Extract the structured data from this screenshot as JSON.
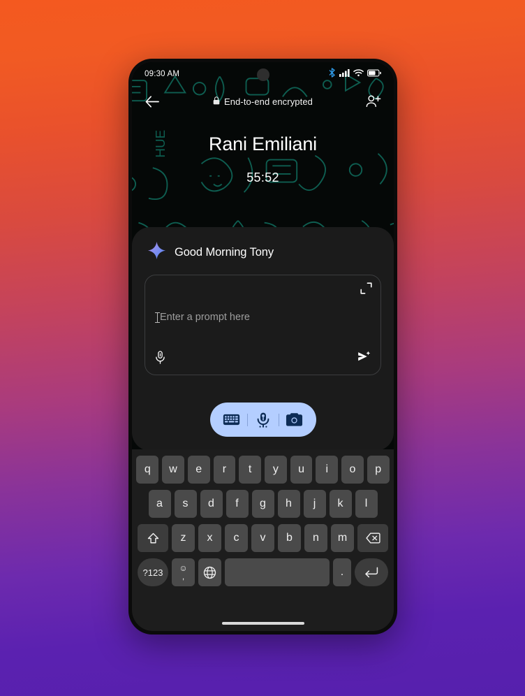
{
  "statusbar": {
    "time": "09:30 AM",
    "icons": [
      "bluetooth-icon",
      "cellular-signal-icon",
      "wifi-icon",
      "battery-icon"
    ],
    "bluetooth_color": "#2f9ae8"
  },
  "appbar": {
    "back_label": "back-arrow",
    "encryption_text": "End-to-end encrypted",
    "lock_icon": "lock-icon",
    "add_participant_icon": "person-add-icon"
  },
  "call": {
    "contact_name": "Rani Emiliani",
    "duration": "55:52"
  },
  "gemini": {
    "sparkle_icon": "gemini-sparkle-icon",
    "greeting": "Good Morning Tony",
    "prompt": {
      "value": "",
      "placeholder": "Enter a prompt here",
      "expand_icon": "expand-icon",
      "mic_icon": "microphone-icon",
      "send_icon": "send-sparkle-icon"
    },
    "mode_pill": {
      "background": "#b4ceff",
      "options": [
        "keyboard-icon",
        "microphone-icon",
        "camera-icon"
      ]
    }
  },
  "keyboard": {
    "row1": [
      "q",
      "w",
      "e",
      "r",
      "t",
      "y",
      "u",
      "i",
      "o",
      "p"
    ],
    "row2": [
      "a",
      "s",
      "d",
      "f",
      "g",
      "h",
      "j",
      "k",
      "l"
    ],
    "row3_shift": "shift-icon",
    "row3": [
      "z",
      "x",
      "c",
      "v",
      "b",
      "n",
      "m"
    ],
    "row3_backspace": "backspace-icon",
    "row4": {
      "symbols": "?123",
      "emoji": "☺",
      "comma": ",",
      "globe": "globe-icon",
      "space": "",
      "period": ".",
      "enter": "enter-icon"
    }
  },
  "system": {
    "home_indicator": "home-indicator"
  },
  "theme": {
    "background_gradient_start": "#f4591f",
    "background_gradient_end": "#5620ad",
    "panel_bg": "#1b1b1b",
    "keyboard_bg": "#1d1d1d",
    "key_bg": "#4a4a4a",
    "wallpaper_doodle": "#0f5d50"
  }
}
